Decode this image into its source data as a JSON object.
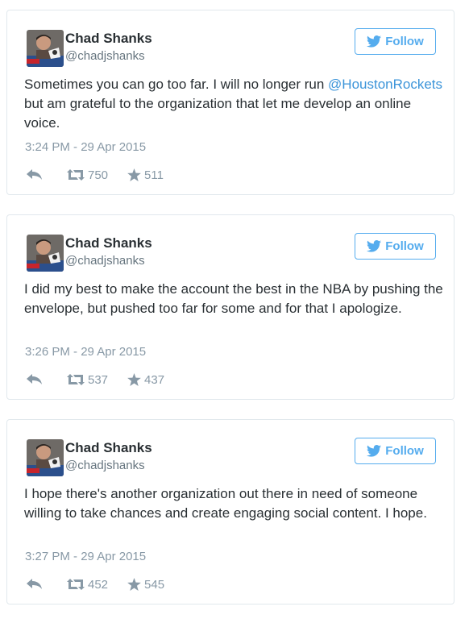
{
  "colors": {
    "accent": "#55acee",
    "link": "#3b94d9",
    "muted": "#8899a6",
    "text": "#292f33",
    "border": "#e1e8ed"
  },
  "tweets": [
    {
      "name": "Chad Shanks",
      "handle": "@chadjshanks",
      "follow_label": "Follow",
      "text_before": "Sometimes you can go too far. I will no longer run ",
      "mention": "@HoustonRockets",
      "text_after": " but am grateful to the organization that let me develop an online voice.",
      "timestamp": "3:24 PM - 29 Apr 2015",
      "retweets": "750",
      "favorites": "511"
    },
    {
      "name": "Chad Shanks",
      "handle": "@chadjshanks",
      "follow_label": "Follow",
      "text_before": "I did my best to make the account the best in the NBA by pushing the envelope, but pushed too far for some and for that I apologize.",
      "mention": "",
      "text_after": "",
      "timestamp": "3:26 PM - 29 Apr 2015",
      "retweets": "537",
      "favorites": "437"
    },
    {
      "name": "Chad Shanks",
      "handle": "@chadjshanks",
      "follow_label": "Follow",
      "text_before": "I hope there's another organization out there in need of someone willing to take chances and create engaging social content. I hope.",
      "mention": "",
      "text_after": "",
      "timestamp": "3:27 PM - 29 Apr 2015",
      "retweets": "452",
      "favorites": "545"
    }
  ],
  "icons": {
    "avatar": "avatar-photo",
    "follow": "twitter-bird-icon",
    "reply": "reply-arrow-icon",
    "retweet": "retweet-icon",
    "favorite": "star-icon"
  }
}
